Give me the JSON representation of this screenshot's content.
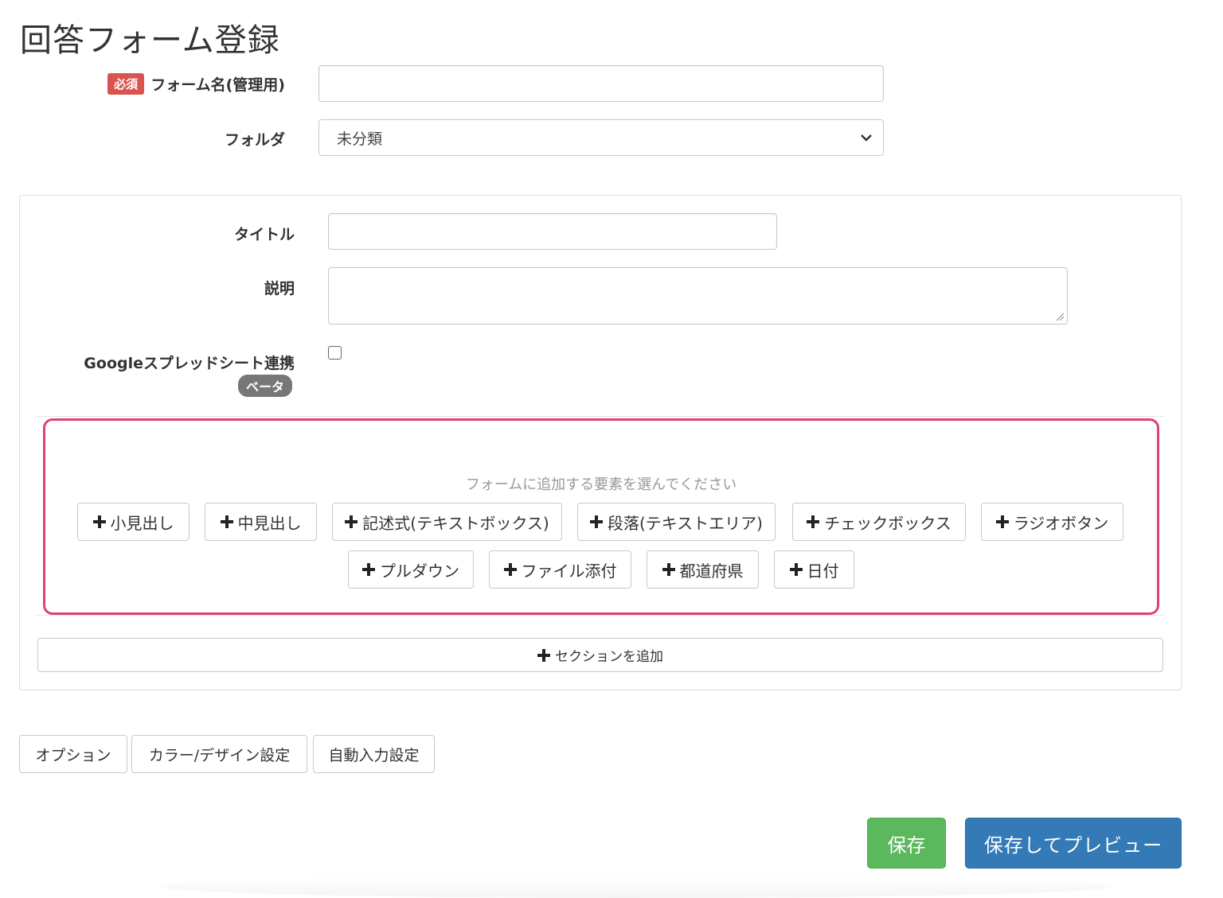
{
  "page": {
    "title": "回答フォーム登録"
  },
  "form_name": {
    "required_badge": "必須",
    "label": "フォーム名(管理用)",
    "value": ""
  },
  "folder": {
    "label": "フォルダ",
    "selected": "未分類"
  },
  "section": {
    "title_label": "タイトル",
    "title_value": "",
    "description_label": "説明",
    "description_value": "",
    "spreadsheet_label": "Googleスプレッドシート連携",
    "spreadsheet_checked": false,
    "beta_badge": "ベータ"
  },
  "elements": {
    "prompt": "フォームに追加する要素を選んでください",
    "row1": [
      "小見出し",
      "中見出し",
      "記述式(テキストボックス)",
      "段落(テキストエリア)",
      "チェックボックス",
      "ラジオボタン"
    ],
    "row2": [
      "プルダウン",
      "ファイル添付",
      "都道府県",
      "日付"
    ]
  },
  "add_section_label": "セクションを追加",
  "options": [
    "オプション",
    "カラー/デザイン設定",
    "自動入力設定"
  ],
  "actions": {
    "save": "保存",
    "save_preview": "保存してプレビュー"
  },
  "colors": {
    "highlight": "#e0436f",
    "save": "#5cb85c",
    "preview": "#337ab7",
    "required": "#d9534f"
  }
}
